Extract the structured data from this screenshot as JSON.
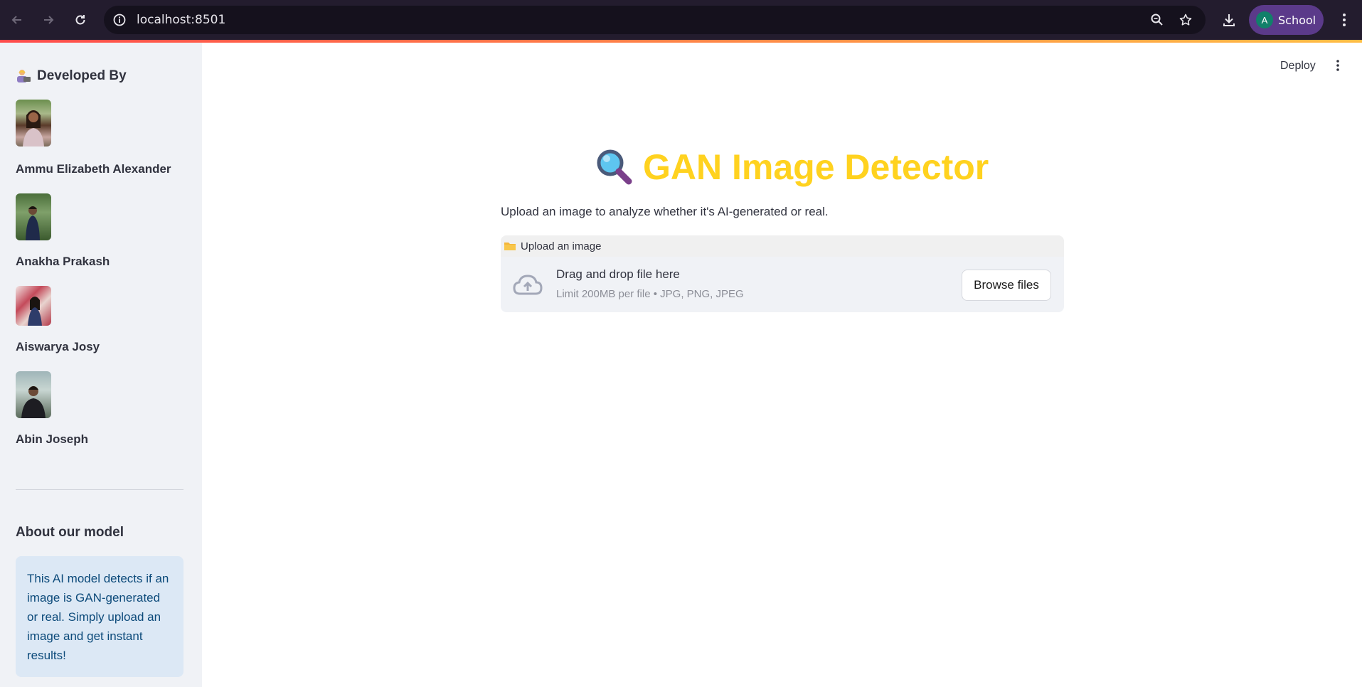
{
  "browser": {
    "url": "localhost:8501",
    "profile_initial": "A",
    "profile_name": "School"
  },
  "sidebar": {
    "header": "Developed By",
    "developers": [
      {
        "name": "Ammu Elizabeth Alexander"
      },
      {
        "name": "Anakha Prakash"
      },
      {
        "name": "Aiswarya Josy"
      },
      {
        "name": "Abin Joseph"
      }
    ],
    "about_title": "About our model",
    "about_text": "This AI model detects if an image is GAN-generated or real. Simply upload an image and get instant results!"
  },
  "toolbar": {
    "deploy_label": "Deploy"
  },
  "main": {
    "title": "GAN Image Detector",
    "subtitle": "Upload an image to analyze whether it's AI-generated or real.",
    "uploader": {
      "label": "Upload an image",
      "drop_title": "Drag and drop file here",
      "limit_text": "Limit 200MB per file • JPG, PNG, JPEG",
      "browse_label": "Browse files"
    }
  },
  "colors": {
    "title": "#ffd21f",
    "sidebar_bg": "#f0f2f6",
    "about_bg": "#dce8f5",
    "about_text": "#0c4a7a",
    "chrome_bg": "#231c2e"
  }
}
